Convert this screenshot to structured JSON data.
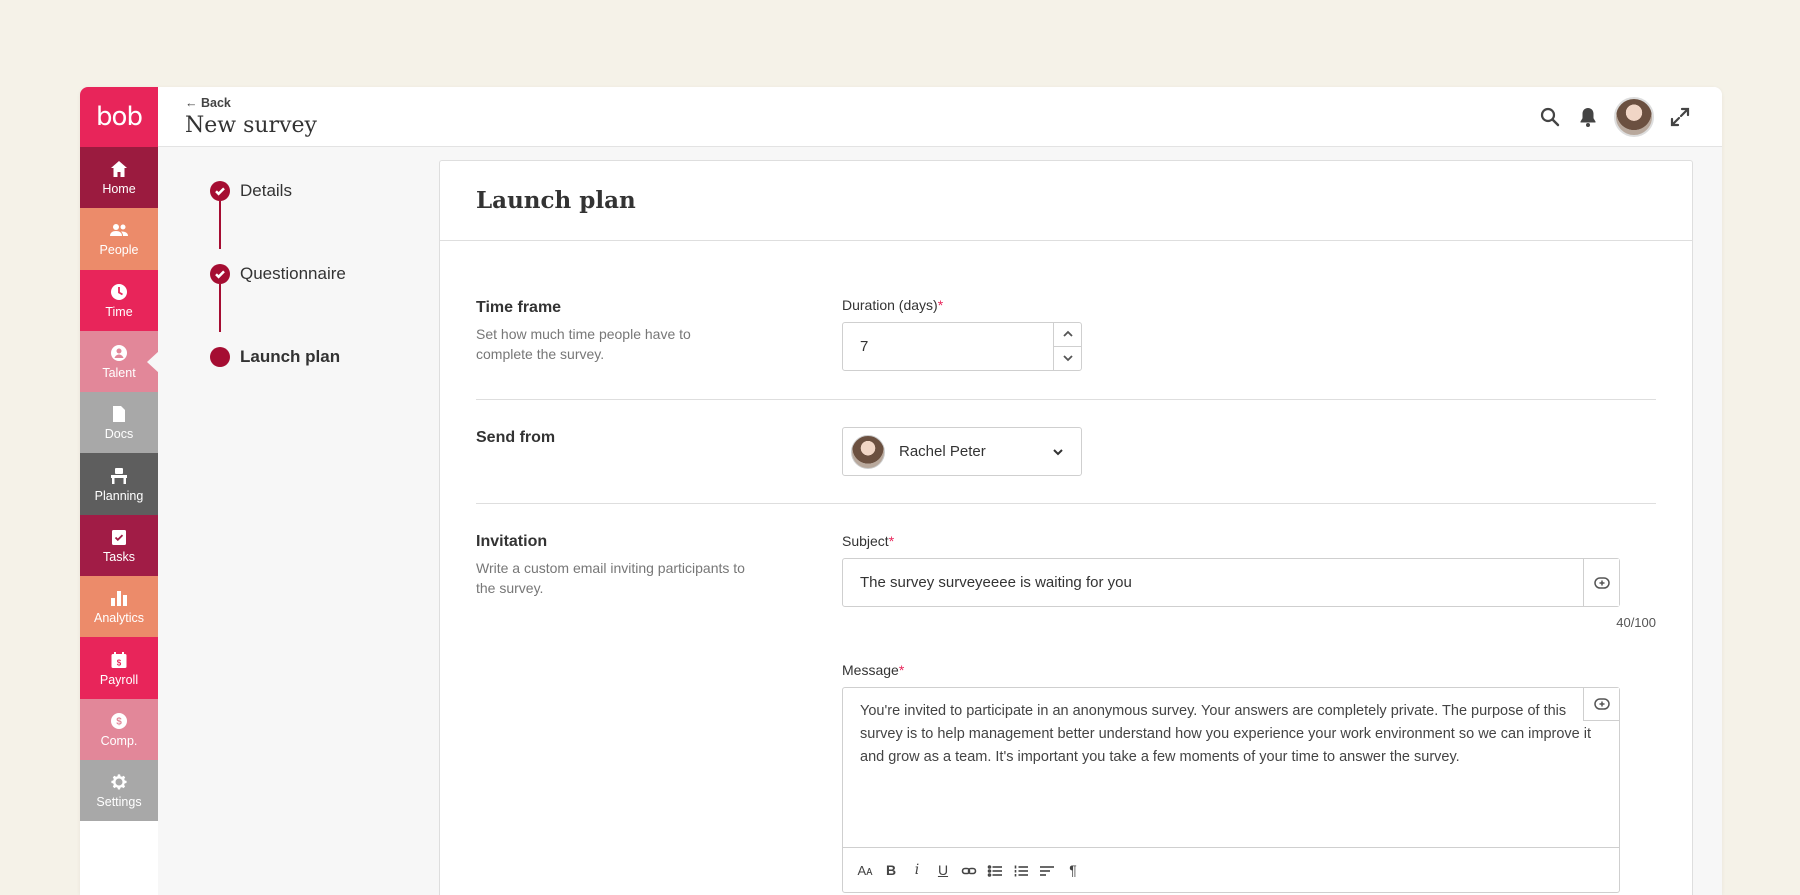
{
  "app": {
    "logo": "bob",
    "colors": {
      "brand": "#e8255a",
      "accent": "#a50d32"
    }
  },
  "sidebar": {
    "items": [
      {
        "label": "Home",
        "icon": "home-icon",
        "color": "#9b1b3f"
      },
      {
        "label": "People",
        "icon": "people-icon",
        "color": "#ec8b6a"
      },
      {
        "label": "Time",
        "icon": "clock-icon",
        "color": "#e8255a"
      },
      {
        "label": "Talent",
        "icon": "talent-icon",
        "color": "#e28799",
        "active": true
      },
      {
        "label": "Docs",
        "icon": "document-icon",
        "color": "#a8a8a8"
      },
      {
        "label": "Planning",
        "icon": "planning-icon",
        "color": "#5e5e5e"
      },
      {
        "label": "Tasks",
        "icon": "tasks-icon",
        "color": "#a11c46"
      },
      {
        "label": "Analytics",
        "icon": "analytics-icon",
        "color": "#ec8b6a"
      },
      {
        "label": "Payroll",
        "icon": "payroll-icon",
        "color": "#e8255a"
      },
      {
        "label": "Comp.",
        "icon": "compensation-icon",
        "color": "#e28799"
      },
      {
        "label": "Settings",
        "icon": "gear-icon",
        "color": "#a8a8a8"
      }
    ]
  },
  "header": {
    "back_label": "Back",
    "title": "New survey"
  },
  "stepper": {
    "steps": [
      {
        "label": "Details",
        "state": "done"
      },
      {
        "label": "Questionnaire",
        "state": "done"
      },
      {
        "label": "Launch plan",
        "state": "current"
      }
    ]
  },
  "panel": {
    "title": "Launch plan",
    "time_frame": {
      "title": "Time frame",
      "description": "Set how much time people have to complete the survey.",
      "duration_label": "Duration (days)",
      "duration_value": "7"
    },
    "send_from": {
      "title": "Send from",
      "sender_name": "Rachel Peter"
    },
    "invitation": {
      "title": "Invitation",
      "description": "Write a custom email inviting participants to the survey.",
      "subject_label": "Subject",
      "subject_value": "The survey surveyeeee is waiting for you",
      "subject_counter": "40/100",
      "message_label": "Message",
      "message_value": "You're invited to participate in an anonymous survey. Your answers are completely private. The purpose of this survey is to help management better understand how you experience your work environment so we can improve it and grow as a team. It's important you take a few moments of your time to answer the survey."
    },
    "required_mark": "*"
  }
}
